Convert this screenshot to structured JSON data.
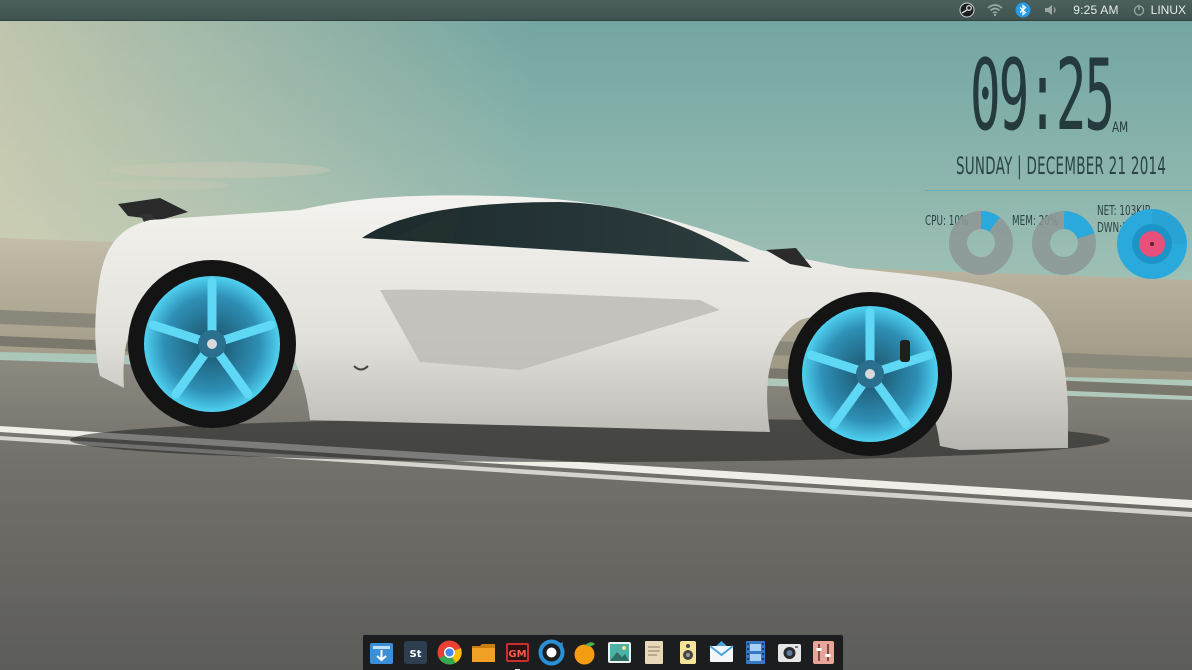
{
  "top_panel": {
    "clock": "9:25 AM",
    "session_label": "LINUX",
    "tray_icons": [
      "steam-icon",
      "wifi-icon",
      "bluetooth-icon",
      "volume-icon"
    ]
  },
  "conky": {
    "time": "09:25",
    "ampm": "AM",
    "date": "SUNDAY | DECEMBER 21 2014",
    "cpu": {
      "label": "CPU: 10%",
      "percent": 10
    },
    "mem": {
      "label": "MEM: 20%",
      "percent": 20
    },
    "net": {
      "up_label": "NET: 103KIB",
      "down_label": "DWN:187MB"
    },
    "colors": {
      "accent": "#2aa9dc",
      "track": "#8c9797",
      "text": "#243a3d",
      "pink": "#e8507a"
    }
  },
  "dock": {
    "items": [
      {
        "name": "software-center",
        "icon": "package-icon",
        "color": "#3a8fd6"
      },
      {
        "name": "sublime-text",
        "icon": "sublime-icon",
        "label": "St",
        "color": "#2c3e50"
      },
      {
        "name": "chrome",
        "icon": "chrome-icon",
        "color": "#e94235"
      },
      {
        "name": "files",
        "icon": "folder-icon",
        "color": "#f0a022"
      },
      {
        "name": "gmail",
        "icon": "gmail-icon",
        "label": "GM",
        "color": "#c9302c"
      },
      {
        "name": "sync",
        "icon": "sync-icon",
        "color": "#2a8fd4"
      },
      {
        "name": "fruit-app",
        "icon": "orange-icon",
        "color": "#f39c12"
      },
      {
        "name": "image-viewer",
        "icon": "image-icon",
        "color": "#4fb0a5"
      },
      {
        "name": "text-editor",
        "icon": "document-icon",
        "color": "#e8d7b8"
      },
      {
        "name": "music-player",
        "icon": "speaker-icon",
        "color": "#f6e39a"
      },
      {
        "name": "mail",
        "icon": "mail-icon",
        "color": "#4aa3df"
      },
      {
        "name": "video-player",
        "icon": "film-icon",
        "color": "#3778c4"
      },
      {
        "name": "camera",
        "icon": "camera-icon",
        "color": "#e6e6e6"
      },
      {
        "name": "settings",
        "icon": "mixer-icon",
        "color": "#e8a69b"
      }
    ]
  }
}
